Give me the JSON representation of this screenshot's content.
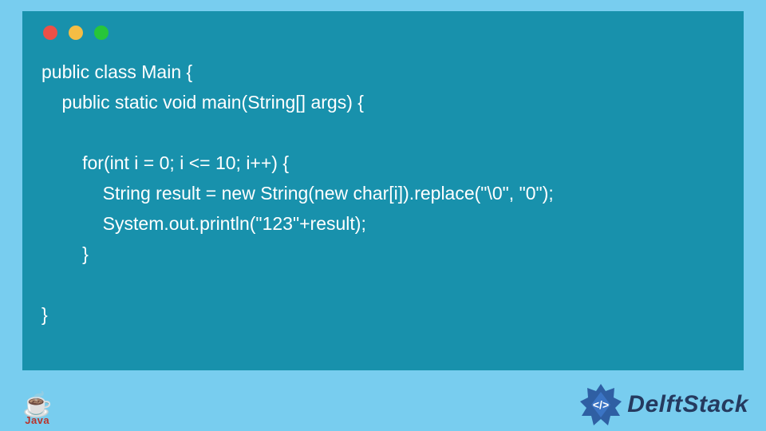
{
  "code": {
    "line1": "public class Main {",
    "line2": "    public static void main(String[] args) {",
    "line3": "",
    "line4": "        for(int i = 0; i <= 10; i++) {",
    "line5": "            String result = new String(new char[i]).replace(\"\\0\", \"0\");",
    "line6": "            System.out.println(\"123\"+result);",
    "line7": "        }",
    "line8": "",
    "line9": "}"
  },
  "footer": {
    "java_label": "Java",
    "brand": "DelftStack"
  },
  "colors": {
    "page_bg": "#78cdef",
    "window_bg": "#1891ac",
    "code_fg": "#ffffff",
    "dot_red": "#ec5047",
    "dot_yellow": "#f5bd44",
    "dot_green": "#27c53a",
    "brand_fg": "#253a5f",
    "java_fg": "#b9342b"
  }
}
